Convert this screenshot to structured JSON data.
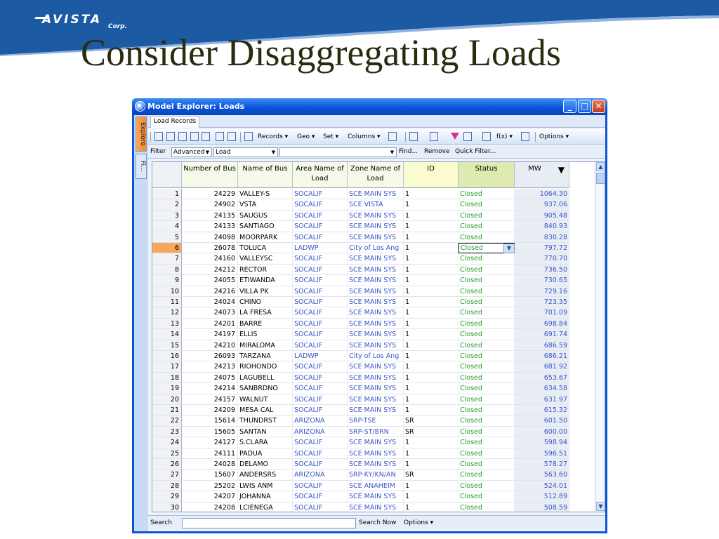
{
  "slide": {
    "logo": "AVISTA",
    "logo_sub": "Corp.",
    "title": "Consider Disaggregating Loads",
    "bar_color": "#1c5aa3"
  },
  "window": {
    "title": "Model Explorer: Loads",
    "min": "_",
    "max": "□",
    "close": "✕"
  },
  "side_tabs": [
    "Explore",
    "Fi..."
  ],
  "doc_tab": "Load Records",
  "toolbar": {
    "records": "Records ▾",
    "geo": "Geo ▾",
    "set": "Set ▾",
    "columns": "Columns ▾",
    "fx": "f(x) ▾",
    "options": "Options ▾"
  },
  "filter": {
    "label": "Filter",
    "mode": "Advanced",
    "object": "Load",
    "expr": "",
    "find": "Find...",
    "remove": "Remove",
    "quick": "Quick Filter..."
  },
  "columns": [
    "Number of Bus",
    "Name of Bus",
    "Area Name of Load",
    "Zone Name of Load",
    "ID",
    "Status",
    "MW"
  ],
  "rows": [
    {
      "n": "1",
      "bus": "24229",
      "name": "VALLEY-S",
      "area": "SOCALIF",
      "zone": "SCE MAIN SYS",
      "id": "1",
      "status": "Closed",
      "mw": "1064.30"
    },
    {
      "n": "2",
      "bus": "24902",
      "name": "VSTA",
      "area": "SOCALIF",
      "zone": "SCE VISTA",
      "id": "1",
      "status": "Closed",
      "mw": "937.06"
    },
    {
      "n": "3",
      "bus": "24135",
      "name": "SAUGUS",
      "area": "SOCALIF",
      "zone": "SCE MAIN SYS",
      "id": "1",
      "status": "Closed",
      "mw": "905.48"
    },
    {
      "n": "4",
      "bus": "24133",
      "name": "SANTIAGO",
      "area": "SOCALIF",
      "zone": "SCE MAIN SYS",
      "id": "1",
      "status": "Closed",
      "mw": "840.93"
    },
    {
      "n": "5",
      "bus": "24098",
      "name": "MOORPARK",
      "area": "SOCALIF",
      "zone": "SCE MAIN SYS",
      "id": "1",
      "status": "Closed",
      "mw": "830.28"
    },
    {
      "n": "6",
      "bus": "26078",
      "name": "TOLUCA",
      "area": "LADWP",
      "zone": "City of Los Ang",
      "id": "1",
      "status": "Closed",
      "mw": "797.72"
    },
    {
      "n": "7",
      "bus": "24160",
      "name": "VALLEYSC",
      "area": "SOCALIF",
      "zone": "SCE MAIN SYS",
      "id": "1",
      "status": "Closed",
      "mw": "770.70"
    },
    {
      "n": "8",
      "bus": "24212",
      "name": "RECTOR",
      "area": "SOCALIF",
      "zone": "SCE MAIN SYS",
      "id": "1",
      "status": "Closed",
      "mw": "736.50"
    },
    {
      "n": "9",
      "bus": "24055",
      "name": "ETIWANDA",
      "area": "SOCALIF",
      "zone": "SCE MAIN SYS",
      "id": "1",
      "status": "Closed",
      "mw": "730.65"
    },
    {
      "n": "10",
      "bus": "24216",
      "name": "VILLA PK",
      "area": "SOCALIF",
      "zone": "SCE MAIN SYS",
      "id": "1",
      "status": "Closed",
      "mw": "729.16"
    },
    {
      "n": "11",
      "bus": "24024",
      "name": "CHINO",
      "area": "SOCALIF",
      "zone": "SCE MAIN SYS",
      "id": "1",
      "status": "Closed",
      "mw": "723.35"
    },
    {
      "n": "12",
      "bus": "24073",
      "name": "LA FRESA",
      "area": "SOCALIF",
      "zone": "SCE MAIN SYS",
      "id": "1",
      "status": "Closed",
      "mw": "701.09"
    },
    {
      "n": "13",
      "bus": "24201",
      "name": "BARRE",
      "area": "SOCALIF",
      "zone": "SCE MAIN SYS",
      "id": "1",
      "status": "Closed",
      "mw": "698.84"
    },
    {
      "n": "14",
      "bus": "24197",
      "name": "ELLIS",
      "area": "SOCALIF",
      "zone": "SCE MAIN SYS",
      "id": "1",
      "status": "Closed",
      "mw": "691.74"
    },
    {
      "n": "15",
      "bus": "24210",
      "name": "MIRALOMA",
      "area": "SOCALIF",
      "zone": "SCE MAIN SYS",
      "id": "1",
      "status": "Closed",
      "mw": "686.59"
    },
    {
      "n": "16",
      "bus": "26093",
      "name": "TARZANA",
      "area": "LADWP",
      "zone": "City of Los Ang",
      "id": "1",
      "status": "Closed",
      "mw": "686.21"
    },
    {
      "n": "17",
      "bus": "24213",
      "name": "RIOHONDO",
      "area": "SOCALIF",
      "zone": "SCE MAIN SYS",
      "id": "1",
      "status": "Closed",
      "mw": "681.92"
    },
    {
      "n": "18",
      "bus": "24075",
      "name": "LAGUBELL",
      "area": "SOCALIF",
      "zone": "SCE MAIN SYS",
      "id": "1",
      "status": "Closed",
      "mw": "653.67"
    },
    {
      "n": "19",
      "bus": "24214",
      "name": "SANBRDNO",
      "area": "SOCALIF",
      "zone": "SCE MAIN SYS",
      "id": "1",
      "status": "Closed",
      "mw": "634.58"
    },
    {
      "n": "20",
      "bus": "24157",
      "name": "WALNUT",
      "area": "SOCALIF",
      "zone": "SCE MAIN SYS",
      "id": "1",
      "status": "Closed",
      "mw": "631.97"
    },
    {
      "n": "21",
      "bus": "24209",
      "name": "MESA CAL",
      "area": "SOCALIF",
      "zone": "SCE MAIN SYS",
      "id": "1",
      "status": "Closed",
      "mw": "615.32"
    },
    {
      "n": "22",
      "bus": "15614",
      "name": "THUNDRST",
      "area": "ARIZONA",
      "zone": "SRP-TSE",
      "id": "SR",
      "status": "Closed",
      "mw": "601.50"
    },
    {
      "n": "23",
      "bus": "15605",
      "name": "SANTAN",
      "area": "ARIZONA",
      "zone": "SRP-ST/BRN",
      "id": "SR",
      "status": "Closed",
      "mw": "600.00"
    },
    {
      "n": "24",
      "bus": "24127",
      "name": "S.CLARA",
      "area": "SOCALIF",
      "zone": "SCE MAIN SYS",
      "id": "1",
      "status": "Closed",
      "mw": "598.94"
    },
    {
      "n": "25",
      "bus": "24111",
      "name": "PADUA",
      "area": "SOCALIF",
      "zone": "SCE MAIN SYS",
      "id": "1",
      "status": "Closed",
      "mw": "596.51"
    },
    {
      "n": "26",
      "bus": "24028",
      "name": "DELAMO",
      "area": "SOCALIF",
      "zone": "SCE MAIN SYS",
      "id": "1",
      "status": "Closed",
      "mw": "578.27"
    },
    {
      "n": "27",
      "bus": "15607",
      "name": "ANDERSRS",
      "area": "ARIZONA",
      "zone": "SRP-KY/KN/AN",
      "id": "SR",
      "status": "Closed",
      "mw": "563.60"
    },
    {
      "n": "28",
      "bus": "25202",
      "name": "LWIS ANM",
      "area": "SOCALIF",
      "zone": "SCE ANAHEIM",
      "id": "1",
      "status": "Closed",
      "mw": "524.01"
    },
    {
      "n": "29",
      "bus": "24207",
      "name": "JOHANNA",
      "area": "SOCALIF",
      "zone": "SCE MAIN SYS",
      "id": "1",
      "status": "Closed",
      "mw": "512.89"
    },
    {
      "n": "30",
      "bus": "24208",
      "name": "LCIENEGA",
      "area": "SOCALIF",
      "zone": "SCE MAIN SYS",
      "id": "1",
      "status": "Closed",
      "mw": "508.59"
    }
  ],
  "selected_row": 6,
  "sort_indicator": "▼",
  "search": {
    "label": "Search",
    "value": "",
    "search_now": "Search Now",
    "options": "Options ▾"
  }
}
